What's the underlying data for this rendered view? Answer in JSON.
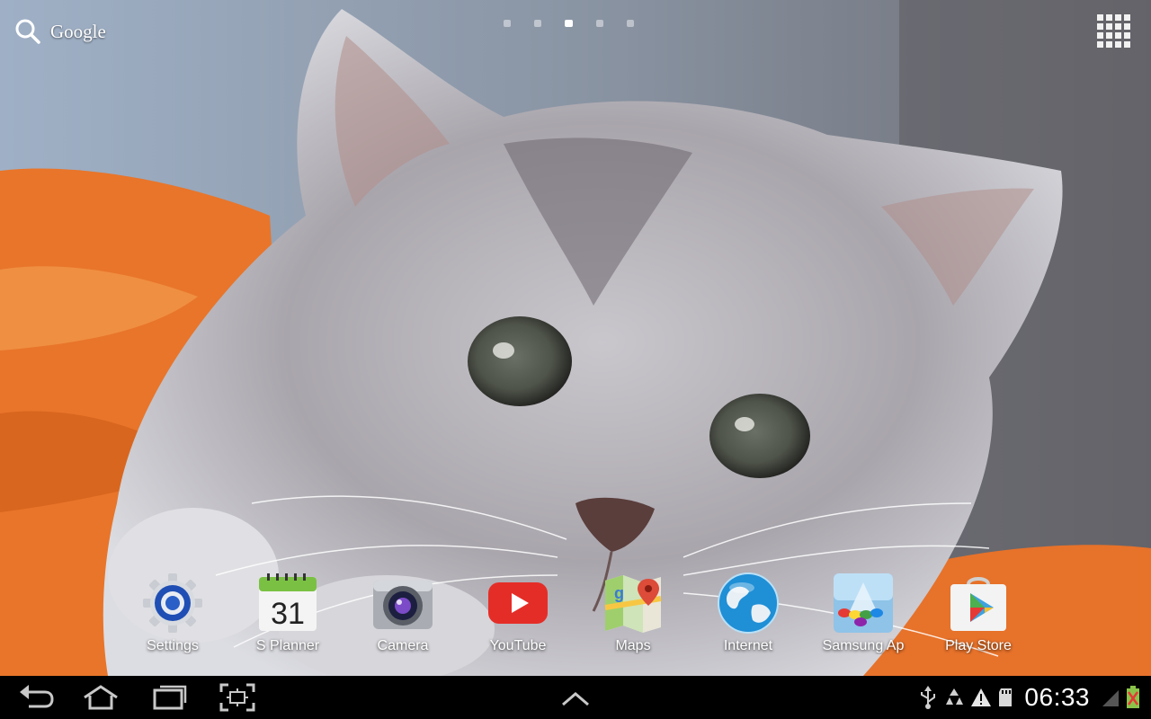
{
  "search": {
    "label": "Google",
    "icon": "search-icon"
  },
  "pager": {
    "pages": 5,
    "active_index": 2
  },
  "apps_button": {
    "icon": "app-grid-icon"
  },
  "dock": {
    "apps": [
      {
        "label": "Settings",
        "icon": "settings-gear-icon"
      },
      {
        "label": "S Planner",
        "icon": "calendar-icon",
        "date_number": "31"
      },
      {
        "label": "Camera",
        "icon": "camera-icon"
      },
      {
        "label": "YouTube",
        "icon": "youtube-icon"
      },
      {
        "label": "Maps",
        "icon": "maps-icon"
      },
      {
        "label": "Internet",
        "icon": "globe-icon"
      },
      {
        "label": "Samsung Ap",
        "icon": "samsung-apps-icon"
      },
      {
        "label": "Play Store",
        "icon": "play-store-icon"
      }
    ]
  },
  "navbar": {
    "buttons": [
      {
        "icon": "back-icon"
      },
      {
        "icon": "home-icon"
      },
      {
        "icon": "recent-apps-icon"
      },
      {
        "icon": "screenshot-icon"
      },
      {
        "icon": "chevron-up-icon"
      }
    ]
  },
  "status": {
    "time": "06:33",
    "icons": [
      "usb-icon",
      "recycle-icon",
      "warning-icon",
      "sd-card-icon",
      "signal-icon",
      "battery-icon"
    ]
  },
  "colors": {
    "navbar": "#000000",
    "accent_youtube": "#e52d27",
    "blanket_orange": "#e8752a"
  }
}
